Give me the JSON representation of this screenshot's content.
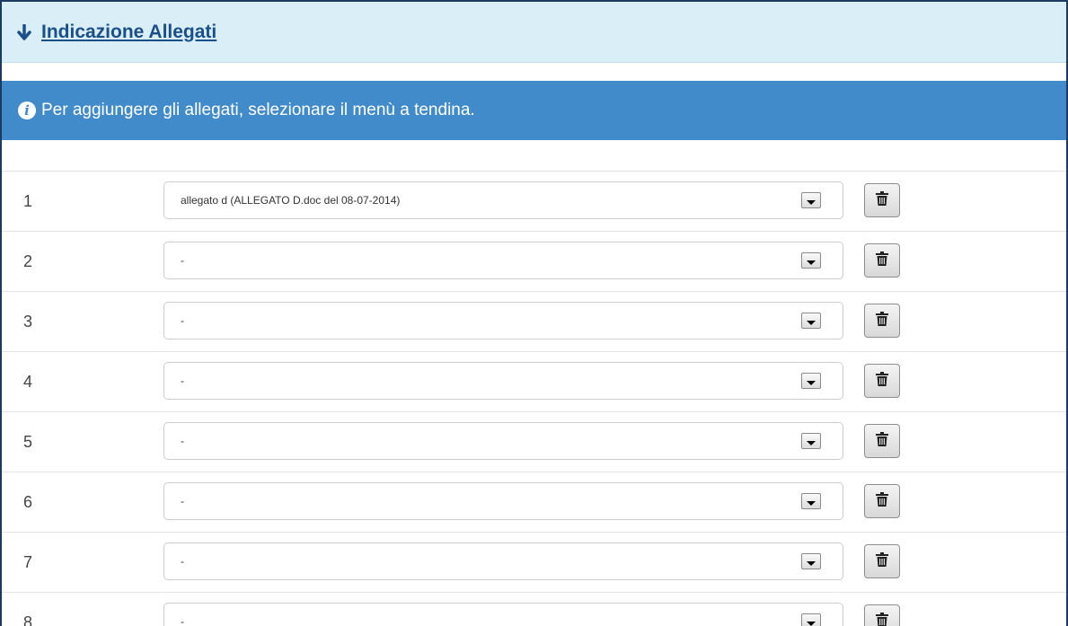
{
  "section": {
    "title": "Indicazione Allegati",
    "icon": "arrow-down-icon"
  },
  "info": {
    "icon": "info-circle-icon",
    "message": "Per aggiungere gli allegati, selezionare il menù a tendina."
  },
  "attachments": [
    {
      "number": "1",
      "selected": "allegato d (ALLEGATO D.doc del 08-07-2014)"
    },
    {
      "number": "2",
      "selected": "-"
    },
    {
      "number": "3",
      "selected": "-"
    },
    {
      "number": "4",
      "selected": "-"
    },
    {
      "number": "5",
      "selected": "-"
    },
    {
      "number": "6",
      "selected": "-"
    },
    {
      "number": "7",
      "selected": "-"
    },
    {
      "number": "8",
      "selected": "-"
    }
  ],
  "colors": {
    "header_bg": "#d9eef7",
    "link": "#1b4f8a",
    "info_bg": "#428bca",
    "frame": "#1d3a63"
  }
}
